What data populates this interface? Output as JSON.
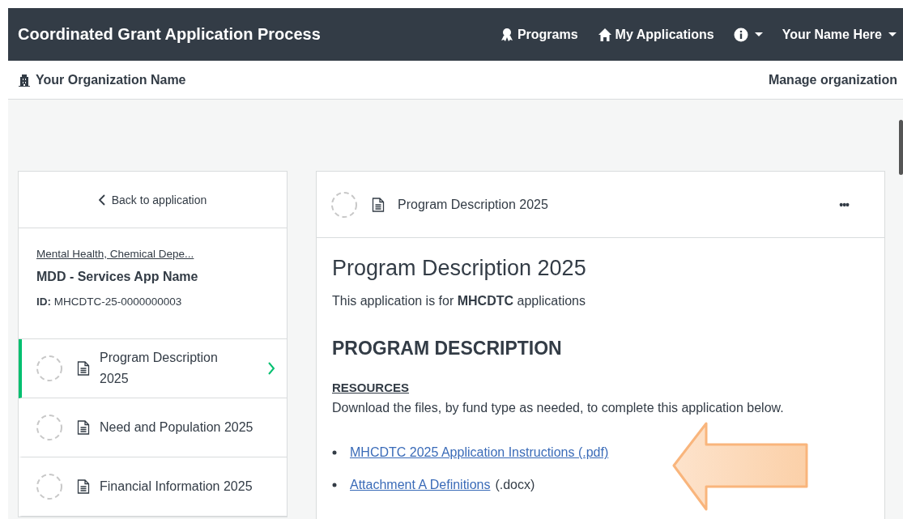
{
  "header": {
    "title": "Coordinated Grant Application Process",
    "nav": [
      {
        "kind": "link",
        "label": "Programs"
      },
      {
        "kind": "link",
        "label": "My Applications"
      },
      {
        "kind": "menu"
      },
      {
        "kind": "menu",
        "label": "Your Name Here"
      }
    ]
  },
  "org_bar": {
    "name": "Your Organization Name",
    "action": "Manage organization"
  },
  "sidebar": {
    "back": "Back to application",
    "agency": "Mental Health, Chemical Depe...",
    "app_name": "MDD - Services App Name",
    "id_label": "ID:",
    "id_value": "MHCDTC-25-0000000003",
    "items": [
      {
        "label": "Program Description 2025",
        "selected": true
      },
      {
        "label": "Need and Population 2025",
        "selected": false
      },
      {
        "label": "Financial Information 2025",
        "selected": false
      }
    ]
  },
  "main": {
    "card_title": "Program Description 2025",
    "menu": "•••",
    "heading": "Program Description 2025",
    "intro": "This application is for **MHCDTC** applications",
    "section": "PROGRAM DESCRIPTION",
    "subsection": "RESOURCES",
    "description": "Download the files, by fund type as needed, to complete this application below.",
    "resources": [
      {
        "link": "MHCDTC 2025 Application Instructions (.pdf)"
      },
      {
        "link": "Attachment A Definitions",
        "suffix": "(.docx)"
      }
    ]
  }
}
